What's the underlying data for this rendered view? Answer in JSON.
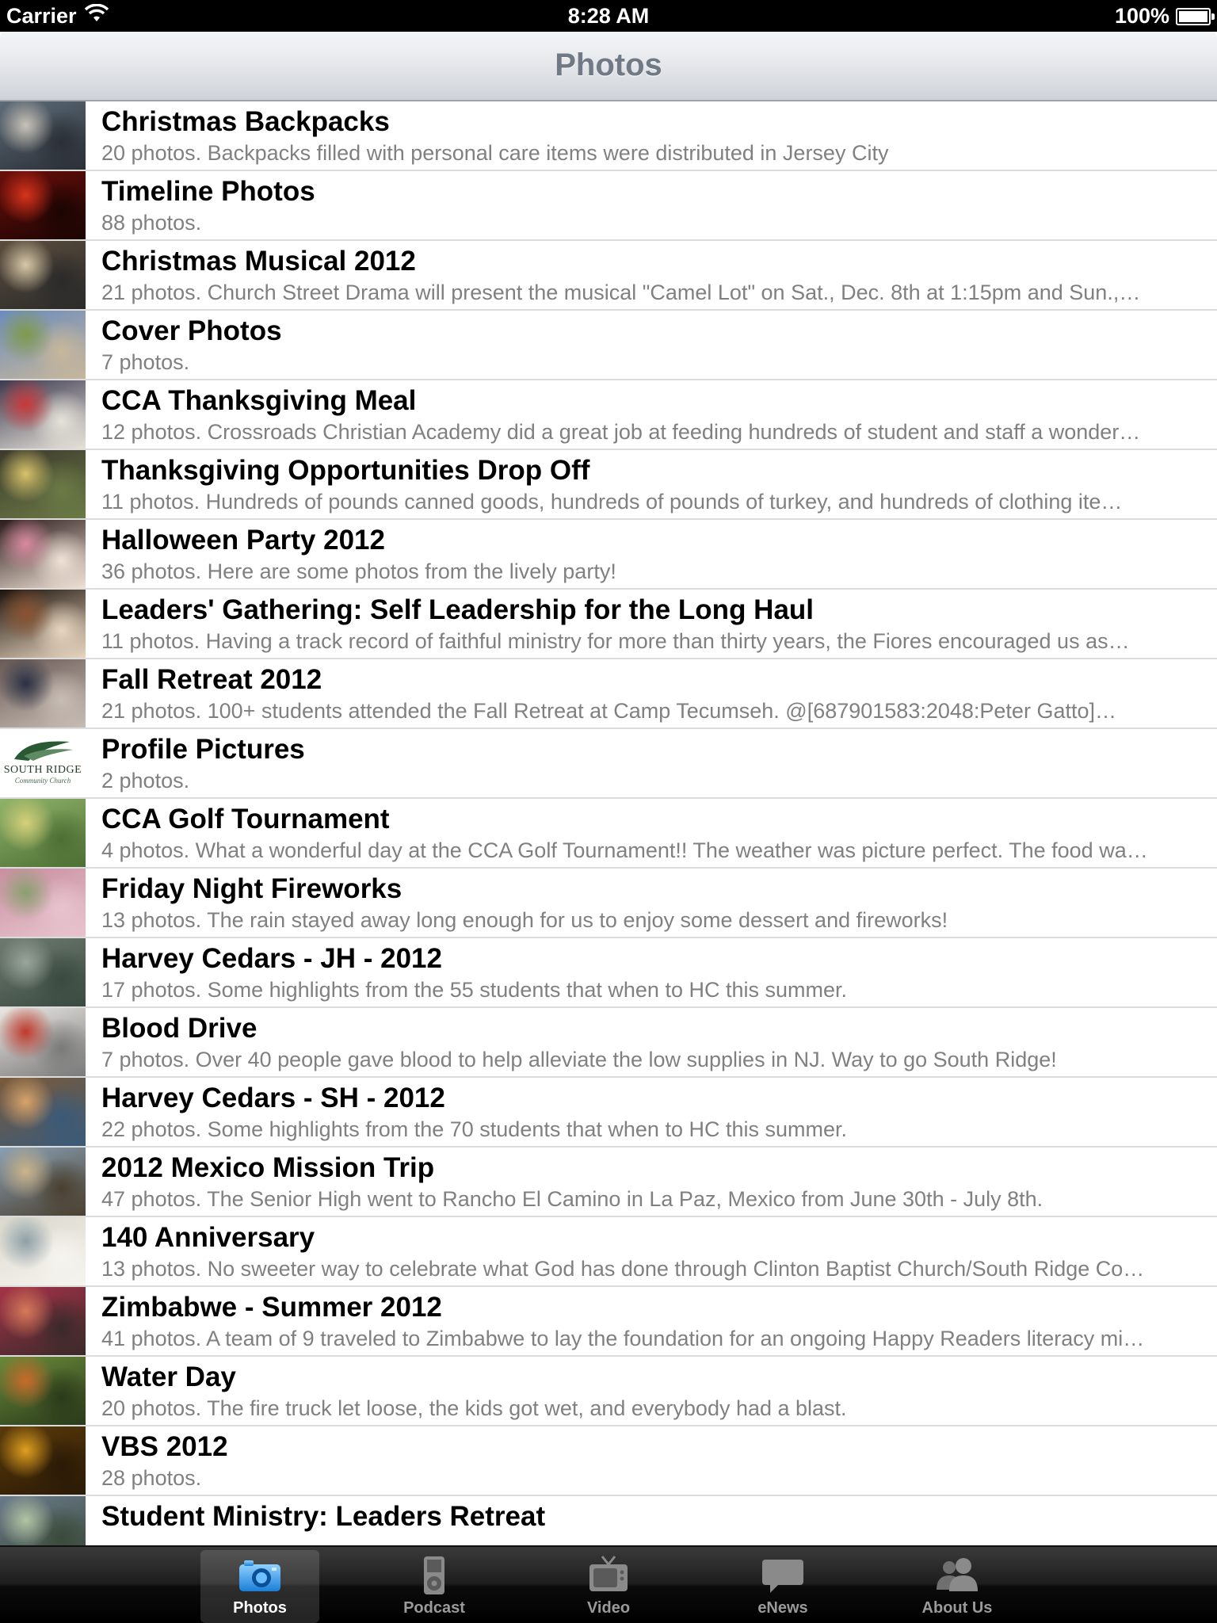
{
  "status_bar": {
    "carrier": "Carrier",
    "time": "8:28 AM",
    "battery": "100%"
  },
  "nav": {
    "title": "Photos"
  },
  "albums": [
    {
      "title": "Christmas Backpacks",
      "description": "20 photos. Backpacks filled with personal care items were distributed in Jersey City"
    },
    {
      "title": "Timeline Photos",
      "description": "88 photos."
    },
    {
      "title": "Christmas Musical 2012",
      "description": "21 photos. Church Street Drama will present the musical \"Camel Lot\" on Sat., Dec. 8th at 1:15pm and Sun.,…"
    },
    {
      "title": "Cover Photos",
      "description": "7 photos."
    },
    {
      "title": "CCA Thanksgiving Meal",
      "description": "12 photos. Crossroads Christian Academy did a great job at feeding hundreds of student and staff a wonder…"
    },
    {
      "title": "Thanksgiving Opportunities Drop Off",
      "description": "11 photos. Hundreds of pounds canned goods, hundreds of pounds of turkey, and hundreds of clothing ite…"
    },
    {
      "title": "Halloween Party 2012",
      "description": "36 photos. Here are some photos from the lively party!"
    },
    {
      "title": "Leaders' Gathering: Self Leadership for the Long Haul",
      "description": "11 photos. Having a track record of faithful ministry for more than thirty years, the Fiores encouraged us as…"
    },
    {
      "title": "Fall Retreat 2012",
      "description": "21 photos. 100+ students  attended the Fall Retreat at Camp Tecumseh.  @[687901583:2048:Peter Gatto]…"
    },
    {
      "title": "Profile Pictures",
      "description": "2 photos."
    },
    {
      "title": "CCA Golf Tournament",
      "description": "4 photos. What a wonderful day at the CCA Golf Tournament!! The weather was picture perfect. The food wa…"
    },
    {
      "title": "Friday Night Fireworks",
      "description": "13 photos. The rain stayed away long enough for us to enjoy some dessert and fireworks!"
    },
    {
      "title": "Harvey Cedars - JH - 2012",
      "description": "17 photos. Some highlights from the 55 students that when to HC this summer."
    },
    {
      "title": "Blood Drive",
      "description": "7 photos. Over 40 people gave blood to help alleviate the low supplies in NJ.  Way to go South Ridge!"
    },
    {
      "title": "Harvey Cedars - SH - 2012",
      "description": "22 photos. Some highlights from the 70 students that when to HC this summer."
    },
    {
      "title": "2012 Mexico Mission Trip",
      "description": "47 photos. The Senior High went to Rancho El Camino in La Paz, Mexico from June 30th - July 8th."
    },
    {
      "title": "140 Anniversary",
      "description": "13 photos. No sweeter way to celebrate what God has done through Clinton Baptist Church/South Ridge Co…"
    },
    {
      "title": "Zimbabwe - Summer 2012",
      "description": "41 photos. A team of 9 traveled to Zimbabwe to lay the foundation for an ongoing Happy Readers literacy mi…"
    },
    {
      "title": "Water Day",
      "description": "20 photos. The fire truck let loose, the kids got wet, and everybody had a blast."
    },
    {
      "title": "VBS 2012",
      "description": "28 photos."
    },
    {
      "title": "Student Ministry: Leaders Retreat",
      "description": ""
    }
  ],
  "thumbnails": [
    {
      "colors": [
        "#5c6b78",
        "#c9c3b8",
        "#2b2f36"
      ]
    },
    {
      "colors": [
        "#6a0e0a",
        "#d8331c",
        "#1a0503"
      ]
    },
    {
      "colors": [
        "#5b4d3d",
        "#d9c9a8",
        "#2a2a2a"
      ]
    },
    {
      "colors": [
        "#6c8cbd",
        "#7f9a4a",
        "#c7b79b"
      ]
    },
    {
      "colors": [
        "#3c3a50",
        "#c9383a",
        "#e7e3da"
      ]
    },
    {
      "colors": [
        "#3c3a2c",
        "#d9c36a",
        "#6b7a46"
      ]
    },
    {
      "colors": [
        "#2a1a1a",
        "#d98aa0",
        "#f0e2d6"
      ]
    },
    {
      "colors": [
        "#1d130c",
        "#8a5230",
        "#e8d6c0"
      ]
    },
    {
      "colors": [
        "#6a5a55",
        "#2a3044",
        "#c8bdb5"
      ]
    },
    {
      "colors": [
        "#ffffff",
        "#2a5a34",
        "#ffffff"
      ],
      "logo": "SOUTH RIDGE",
      "logo_sub": "Community Church"
    },
    {
      "colors": [
        "#8fb36a",
        "#d6d07a",
        "#4d6f34"
      ]
    },
    {
      "colors": [
        "#c98fa0",
        "#8aa070",
        "#e8c4cf"
      ]
    },
    {
      "colors": [
        "#6e7a70",
        "#9aa69c",
        "#3a4a40"
      ]
    },
    {
      "colors": [
        "#e9e6e1",
        "#c0392b",
        "#7a7a7a"
      ]
    },
    {
      "colors": [
        "#7a5a3a",
        "#d8a36a",
        "#3a5a7a"
      ]
    },
    {
      "colors": [
        "#8aa0b4",
        "#ccb48a",
        "#4a4030"
      ]
    },
    {
      "colors": [
        "#dad8cc",
        "#8ea0a8",
        "#f6f4ef"
      ]
    },
    {
      "colors": [
        "#a63248",
        "#d67a5a",
        "#3a2a2a"
      ]
    },
    {
      "colors": [
        "#6a8a3a",
        "#c96a2a",
        "#2a3a1a"
      ]
    },
    {
      "colors": [
        "#5a3a0a",
        "#e0a020",
        "#2a1a06"
      ]
    },
    {
      "colors": [
        "#6a7a8a",
        "#b4c4a4",
        "#3a4a3a"
      ]
    }
  ],
  "tabs": [
    {
      "label": "Photos",
      "icon": "camera-icon",
      "selected": true
    },
    {
      "label": "Podcast",
      "icon": "ipod-icon",
      "selected": false
    },
    {
      "label": "Video",
      "icon": "tv-icon",
      "selected": false
    },
    {
      "label": "eNews",
      "icon": "speech-bubble-icon",
      "selected": false
    },
    {
      "label": "About Us",
      "icon": "people-icon",
      "selected": false
    }
  ]
}
